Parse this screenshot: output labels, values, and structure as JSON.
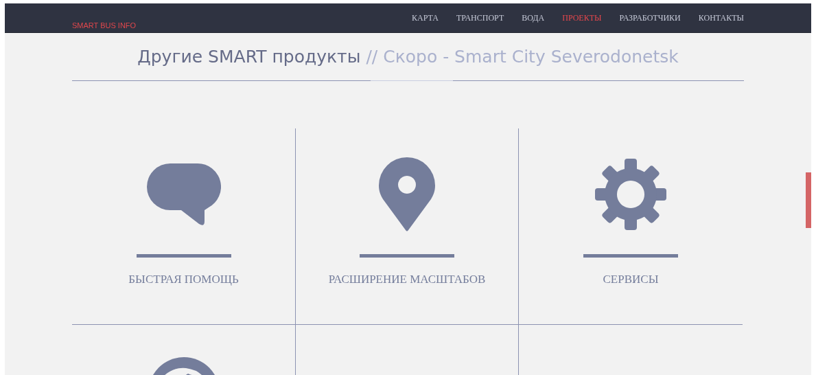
{
  "navbar": {
    "logo": "SMART BUS INFO",
    "links": [
      {
        "label": "КАРТА",
        "selected": false
      },
      {
        "label": "ТРАНСПОРТ",
        "selected": false
      },
      {
        "label": "ВОДА",
        "selected": false
      },
      {
        "label": "ПРОЕКТЫ",
        "selected": true
      },
      {
        "label": "РАЗРАБОТЧИКИ",
        "selected": false
      },
      {
        "label": "КОНТАКТЫ",
        "selected": false
      }
    ]
  },
  "heading": {
    "main": "Другие SMART продукты",
    "sub": "// Скоро - Smart City Severodonetsk"
  },
  "features": [
    {
      "kind": "chat",
      "label": "БЫСТРАЯ ПОМОЩЬ"
    },
    {
      "kind": "pin",
      "label": "РАСШИРЕНИЕ МАСШТАБОВ"
    },
    {
      "kind": "gear",
      "label": "СЕРВИСЫ"
    },
    {
      "kind": "globe"
    },
    {
      "kind": "empty"
    },
    {
      "kind": "empty"
    }
  ]
}
